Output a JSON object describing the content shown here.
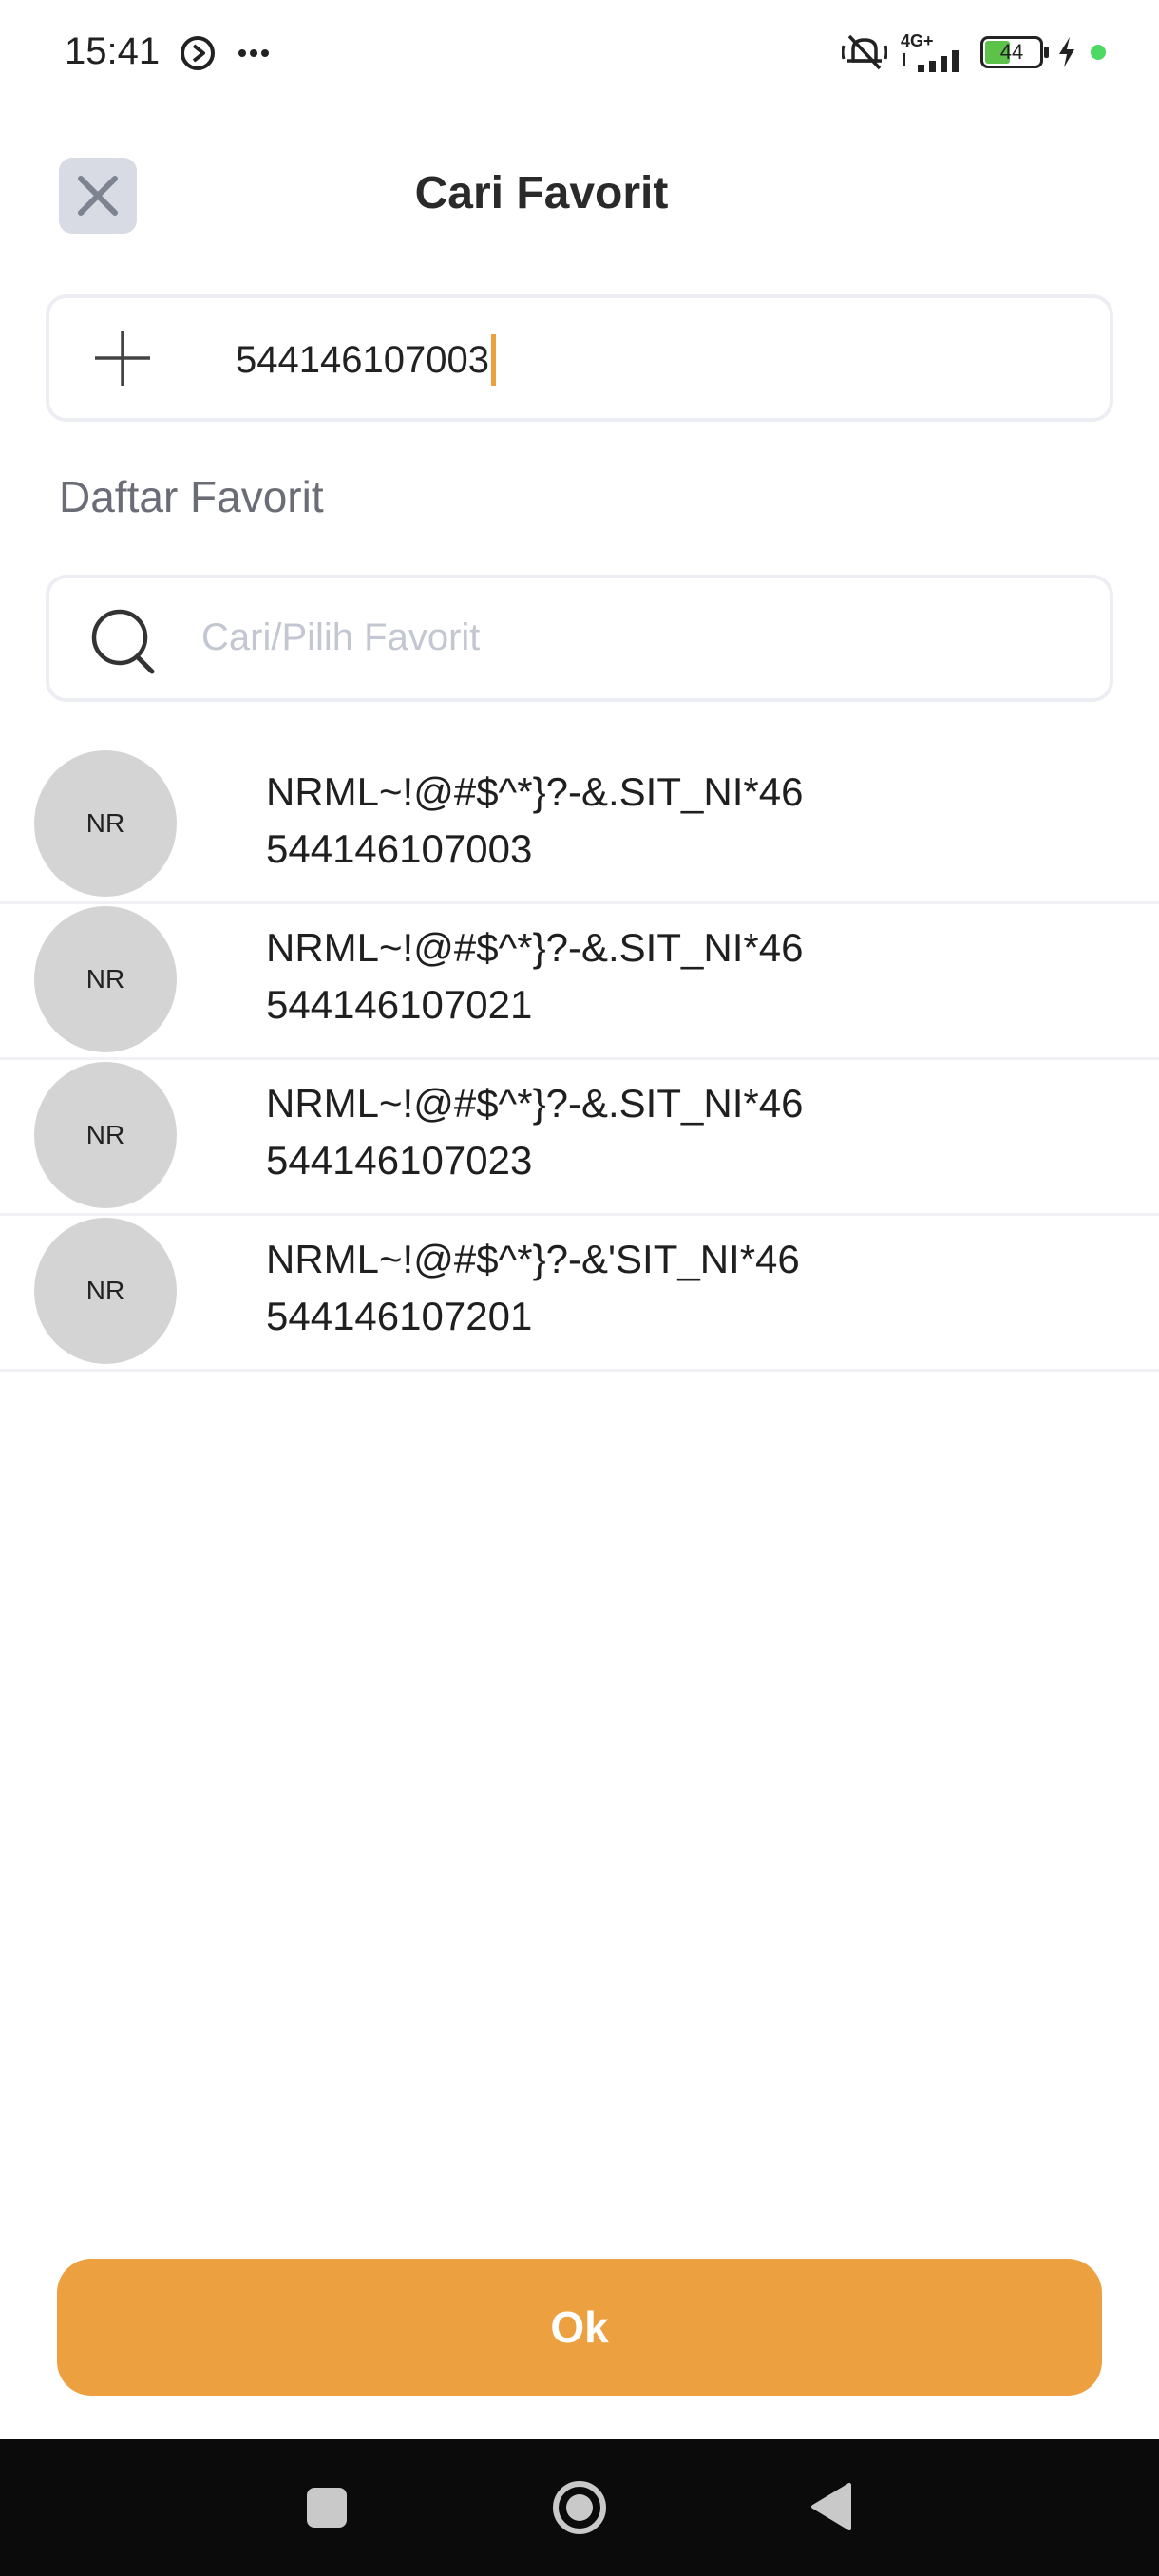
{
  "status_bar": {
    "time": "15:41",
    "network": "4G+",
    "battery": "44",
    "icons": [
      "play-circle-icon",
      "more-dots-icon",
      "mute-icon",
      "signal-icon",
      "battery-icon",
      "charging-icon"
    ]
  },
  "header": {
    "title": "Cari Favorit",
    "close_icon": "close-icon"
  },
  "account_input": {
    "value": "544146107003",
    "icon": "plus-icon"
  },
  "favorites": {
    "section_label": "Daftar Favorit",
    "search_placeholder": "Cari/Pilih Favorit",
    "items": [
      {
        "initials": "NR",
        "name": "NRML~!@#$^*}?-&.SIT_NI*46",
        "number": "544146107003"
      },
      {
        "initials": "NR",
        "name": "NRML~!@#$^*}?-&.SIT_NI*46",
        "number": "544146107021"
      },
      {
        "initials": "NR",
        "name": "NRML~!@#$^*}?-&.SIT_NI*46",
        "number": "544146107023"
      },
      {
        "initials": "NR",
        "name": "NRML~!@#$^*}?-&'SIT_NI*46",
        "number": "544146107201"
      }
    ]
  },
  "actions": {
    "ok_label": "Ok"
  },
  "colors": {
    "accent": "#eda040",
    "close_bg": "#d8dbe4",
    "avatar_bg": "#d4d4d4"
  }
}
